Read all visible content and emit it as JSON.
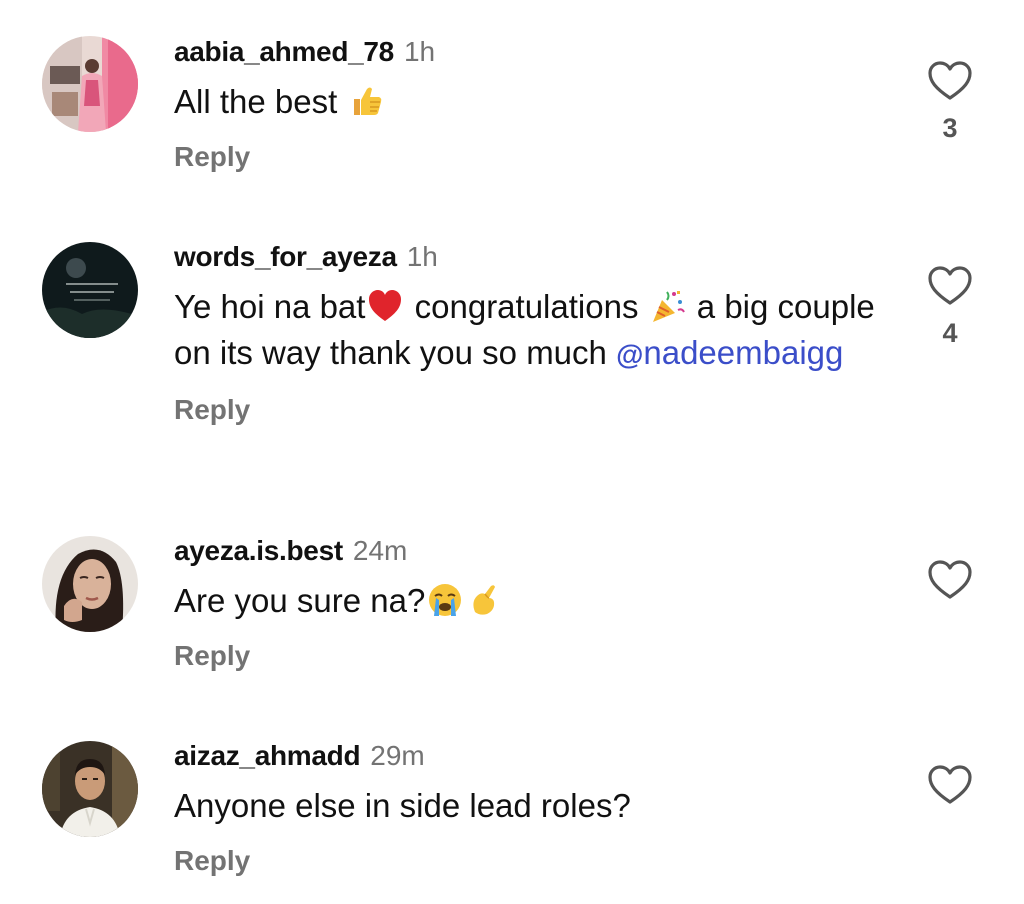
{
  "comments": [
    {
      "username": "aabia_ahmed_78",
      "time": "1h",
      "text_parts": [
        "All the best "
      ],
      "emojis": [
        "thumbs-up"
      ],
      "reply_label": "Reply",
      "likes": "3"
    },
    {
      "username": "words_for_ayeza",
      "time": "1h",
      "text_parts": [
        "Ye hoi na bat",
        " congratulations ",
        " a big couple on its way thank you so much "
      ],
      "emojis": [
        "red-heart",
        "party-popper"
      ],
      "mention": "nadeembaigg",
      "reply_label": "Reply",
      "likes": "4"
    },
    {
      "username": "ayeza.is.best",
      "time": "24m",
      "text_parts": [
        "Are you sure na?"
      ],
      "emojis": [
        "loudly-crying-face",
        "pinching-hand"
      ],
      "reply_label": "Reply",
      "likes": ""
    },
    {
      "username": "aizaz_ahmadd",
      "time": "29m",
      "text_parts": [
        "Anyone else in side lead roles?"
      ],
      "emojis": [],
      "reply_label": "Reply",
      "likes": ""
    }
  ],
  "colors": {
    "text": "#111111",
    "muted": "#737373",
    "mention": "#3b4ec9"
  }
}
